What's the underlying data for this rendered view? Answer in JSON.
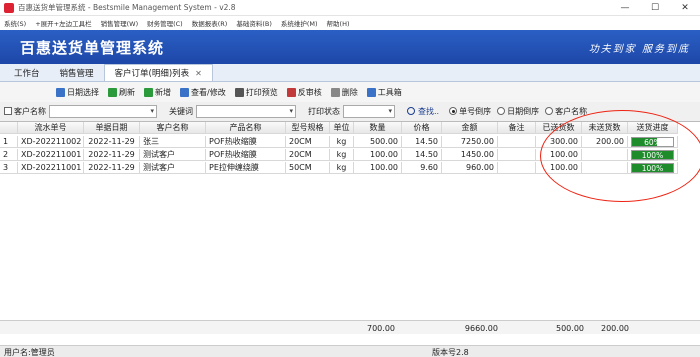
{
  "window": {
    "title": "百惠送货单管理系统 - Bestsmile Management System - v2.8",
    "minimize": "—",
    "maximize": "☐",
    "close": "✕"
  },
  "menu": [
    "系统(S)",
    "+展开+左边工具栏",
    "销售管理(W)",
    "财务管理(C)",
    "数据报表(R)",
    "基础资料(B)",
    "系统维护(M)",
    "帮助(H)"
  ],
  "banner": {
    "app_title": "百惠送货单管理系统",
    "slogan": "功夫到家  服务到底"
  },
  "tabs": [
    {
      "label": "工作台",
      "active": false
    },
    {
      "label": "销售管理",
      "active": false
    },
    {
      "label": "客户订单(明细)列表",
      "active": true,
      "close": "✕"
    }
  ],
  "toolbar": [
    {
      "label": "日期选择",
      "icon": "calendar-icon",
      "color": "#3a72c8"
    },
    {
      "label": "刷新",
      "icon": "refresh-icon",
      "color": "#2a9a3a"
    },
    {
      "label": "新增",
      "icon": "add-icon",
      "color": "#2a9a3a"
    },
    {
      "label": "查看/修改",
      "icon": "edit-icon",
      "color": "#3a72c8"
    },
    {
      "label": "打印预览",
      "icon": "print-icon",
      "color": "#555555"
    },
    {
      "label": "反审核",
      "icon": "unaudit-icon",
      "color": "#c23a3a"
    },
    {
      "label": "删除",
      "icon": "delete-icon",
      "color": "#888888"
    },
    {
      "label": "工具箱",
      "icon": "toolbox-icon",
      "color": "#3a72c8"
    }
  ],
  "filters": {
    "customer_label": "客户名称",
    "keyword_label": "关键词",
    "print_status_label": "打印状态",
    "search_label": "查找..",
    "arrow": "▾",
    "sort_options": [
      {
        "label": "单号倒序",
        "selected": true
      },
      {
        "label": "日期倒序",
        "selected": false
      },
      {
        "label": "客户名称",
        "selected": false
      }
    ]
  },
  "table": {
    "columns": [
      "",
      "流水单号",
      "单据日期",
      "客户名称",
      "产品名称",
      "型号规格",
      "单位",
      "数量",
      "价格",
      "金额",
      "备注",
      "已送货数",
      "未送货数",
      "送货进度"
    ],
    "rows": [
      {
        "no": "1",
        "order": "XD-202211002",
        "date": "2022-11-29",
        "customer": "张三",
        "product": "POF热收缩膜",
        "spec": "20CM",
        "unit": "kg",
        "qty": "500.00",
        "price": "14.50",
        "amount": "7250.00",
        "remark": "",
        "delivered": "300.00",
        "undelivered": "200.00",
        "progress": 0.6,
        "progress_label": "60%"
      },
      {
        "no": "2",
        "order": "XD-202211001",
        "date": "2022-11-29",
        "customer": "测试客户",
        "product": "POF热收缩膜",
        "spec": "20CM",
        "unit": "kg",
        "qty": "100.00",
        "price": "14.50",
        "amount": "1450.00",
        "remark": "",
        "delivered": "100.00",
        "undelivered": "",
        "progress": 1.0,
        "progress_label": "100%"
      },
      {
        "no": "3",
        "order": "XD-202211001",
        "date": "2022-11-29",
        "customer": "测试客户",
        "product": "PE拉伸缠绕膜",
        "spec": "50CM",
        "unit": "kg",
        "qty": "100.00",
        "price": "9.60",
        "amount": "960.00",
        "remark": "",
        "delivered": "100.00",
        "undelivered": "",
        "progress": 1.0,
        "progress_label": "100%"
      }
    ],
    "totals": {
      "qty": "700.00",
      "amount": "9660.00",
      "delivered": "500.00",
      "undelivered": "200.00"
    }
  },
  "status": {
    "user": "用户名:管理员",
    "version": "版本号2.8"
  },
  "colors": {
    "banner": "#1d47a8",
    "progress": "#1e8c2a",
    "annotation": "#e21111"
  }
}
